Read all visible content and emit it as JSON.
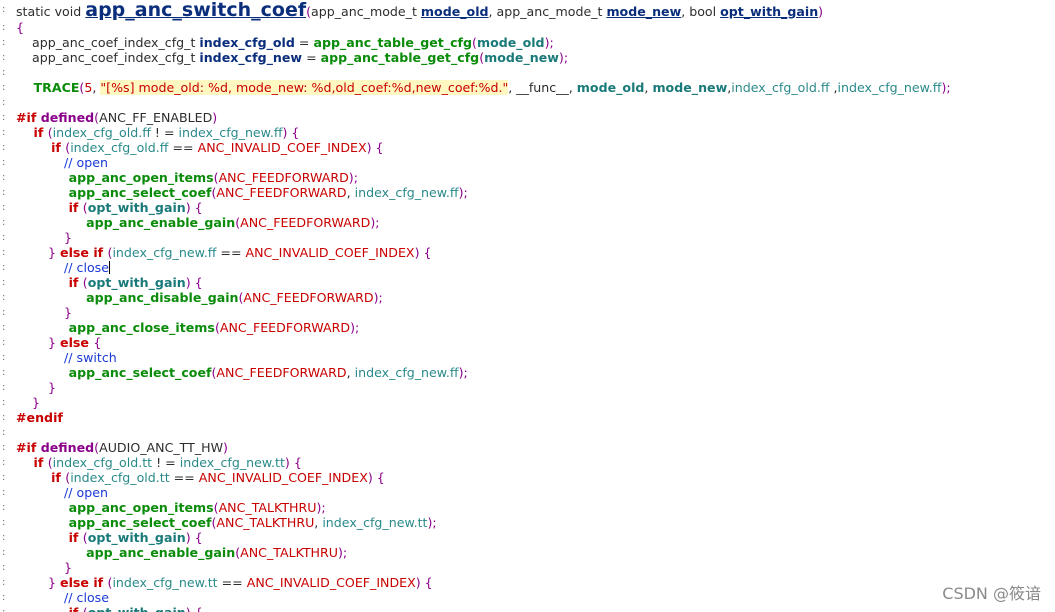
{
  "editor": {
    "watermark": "CSDN @筱谙",
    "lines": [
      {
        "big": true,
        "tokens": [
          [
            "t-kw-norm",
            "static void "
          ],
          [
            "t-fname-big",
            "app_anc_switch_coef"
          ],
          [
            "t-punct",
            "("
          ],
          [
            "t-plain",
            "app_anc_mode_t "
          ],
          [
            "t-param",
            "mode_old"
          ],
          [
            "t-plain",
            ", app_anc_mode_t "
          ],
          [
            "t-param",
            "mode_new"
          ],
          [
            "t-plain",
            ", bool "
          ],
          [
            "t-param",
            "opt_with_gain"
          ],
          [
            "t-punct",
            ")"
          ]
        ]
      },
      {
        "tokens": [
          [
            "t-punct",
            "{"
          ]
        ]
      },
      {
        "tokens": [
          [
            "t-plain",
            "    app_anc_coef_index_cfg_t "
          ],
          [
            "t-var",
            "index_cfg_old"
          ],
          [
            "t-plain",
            " = "
          ],
          [
            "t-func",
            "app_anc_table_get_cfg"
          ],
          [
            "t-punct",
            "("
          ],
          [
            "t-field-b",
            "mode_old"
          ],
          [
            "t-punct",
            ");"
          ]
        ]
      },
      {
        "tokens": [
          [
            "t-plain",
            "    app_anc_coef_index_cfg_t "
          ],
          [
            "t-var",
            "index_cfg_new"
          ],
          [
            "t-plain",
            " = "
          ],
          [
            "t-func",
            "app_anc_table_get_cfg"
          ],
          [
            "t-punct",
            "("
          ],
          [
            "t-field-b",
            "mode_new"
          ],
          [
            "t-punct",
            ");"
          ]
        ]
      },
      {
        "tokens": []
      },
      {
        "tokens": [
          [
            "t-func",
            "    TRACE"
          ],
          [
            "t-punct",
            "("
          ],
          [
            "t-num",
            "5"
          ],
          [
            "t-plain",
            ", "
          ],
          [
            "t-str",
            "\"[%s] mode_old: %d, mode_new: %d,old_coef:%d,new_coef:%d.\""
          ],
          [
            "t-plain",
            ", __func__, "
          ],
          [
            "t-field-b",
            "mode_old"
          ],
          [
            "t-plain",
            ", "
          ],
          [
            "t-field-b",
            "mode_new"
          ],
          [
            "t-plain",
            ","
          ],
          [
            "t-field",
            "index_cfg_old.ff"
          ],
          [
            "t-plain",
            " ,"
          ],
          [
            "t-field",
            "index_cfg_new.ff"
          ],
          [
            "t-punct",
            ");"
          ]
        ]
      },
      {
        "tokens": []
      },
      {
        "tokens": [
          [
            "t-kw",
            "#if "
          ],
          [
            "t-pp",
            "defined"
          ],
          [
            "t-punct",
            "("
          ],
          [
            "t-plain",
            "ANC_FF_ENABLED"
          ],
          [
            "t-punct",
            ")"
          ]
        ]
      },
      {
        "tokens": [
          [
            "t-kw",
            "    if "
          ],
          [
            "t-punct",
            "("
          ],
          [
            "t-field",
            "index_cfg_old.ff"
          ],
          [
            "t-plain",
            " ! = "
          ],
          [
            "t-field",
            "index_cfg_new.ff"
          ],
          [
            "t-punct",
            ") {"
          ]
        ]
      },
      {
        "tokens": [
          [
            "t-kw",
            "        if "
          ],
          [
            "t-punct",
            "("
          ],
          [
            "t-field",
            "index_cfg_old.ff"
          ],
          [
            "t-plain",
            " == "
          ],
          [
            "t-macro",
            "ANC_INVALID_COEF_INDEX"
          ],
          [
            "t-punct",
            ") {"
          ]
        ]
      },
      {
        "tokens": [
          [
            "t-comment",
            "            // open"
          ]
        ]
      },
      {
        "tokens": [
          [
            "t-func",
            "            app_anc_open_items"
          ],
          [
            "t-punct",
            "("
          ],
          [
            "t-macro",
            "ANC_FEEDFORWARD"
          ],
          [
            "t-punct",
            ");"
          ]
        ]
      },
      {
        "tokens": [
          [
            "t-func",
            "            app_anc_select_coef"
          ],
          [
            "t-punct",
            "("
          ],
          [
            "t-macro",
            "ANC_FEEDFORWARD"
          ],
          [
            "t-plain",
            ", "
          ],
          [
            "t-field",
            "index_cfg_new.ff"
          ],
          [
            "t-punct",
            ");"
          ]
        ]
      },
      {
        "tokens": [
          [
            "t-kw",
            "            if "
          ],
          [
            "t-punct",
            "("
          ],
          [
            "t-field-b",
            "opt_with_gain"
          ],
          [
            "t-punct",
            ") {"
          ]
        ]
      },
      {
        "tokens": [
          [
            "t-func",
            "                app_anc_enable_gain"
          ],
          [
            "t-punct",
            "("
          ],
          [
            "t-macro",
            "ANC_FEEDFORWARD"
          ],
          [
            "t-punct",
            ");"
          ]
        ]
      },
      {
        "tokens": [
          [
            "t-punct",
            "            }"
          ]
        ]
      },
      {
        "tokens": [
          [
            "t-punct",
            "        } "
          ],
          [
            "t-kw",
            "else if "
          ],
          [
            "t-punct",
            "("
          ],
          [
            "t-field",
            "index_cfg_new.ff"
          ],
          [
            "t-plain",
            " == "
          ],
          [
            "t-macro",
            "ANC_INVALID_COEF_INDEX"
          ],
          [
            "t-punct",
            ") {"
          ]
        ]
      },
      {
        "caret": true,
        "tokens": [
          [
            "t-comment",
            "            // close"
          ]
        ]
      },
      {
        "tokens": [
          [
            "t-kw",
            "            if "
          ],
          [
            "t-punct",
            "("
          ],
          [
            "t-field-b",
            "opt_with_gain"
          ],
          [
            "t-punct",
            ") {"
          ]
        ]
      },
      {
        "tokens": [
          [
            "t-func",
            "                app_anc_disable_gain"
          ],
          [
            "t-punct",
            "("
          ],
          [
            "t-macro",
            "ANC_FEEDFORWARD"
          ],
          [
            "t-punct",
            ");"
          ]
        ]
      },
      {
        "tokens": [
          [
            "t-punct",
            "            }"
          ]
        ]
      },
      {
        "tokens": [
          [
            "t-func",
            "            app_anc_close_items"
          ],
          [
            "t-punct",
            "("
          ],
          [
            "t-macro",
            "ANC_FEEDFORWARD"
          ],
          [
            "t-punct",
            ");"
          ]
        ]
      },
      {
        "tokens": [
          [
            "t-punct",
            "        } "
          ],
          [
            "t-kw",
            "else "
          ],
          [
            "t-punct",
            "{"
          ]
        ]
      },
      {
        "tokens": [
          [
            "t-comment",
            "            // switch"
          ]
        ]
      },
      {
        "tokens": [
          [
            "t-func",
            "            app_anc_select_coef"
          ],
          [
            "t-punct",
            "("
          ],
          [
            "t-macro",
            "ANC_FEEDFORWARD"
          ],
          [
            "t-plain",
            ", "
          ],
          [
            "t-field",
            "index_cfg_new.ff"
          ],
          [
            "t-punct",
            ");"
          ]
        ]
      },
      {
        "tokens": [
          [
            "t-punct",
            "        }"
          ]
        ]
      },
      {
        "tokens": [
          [
            "t-punct",
            "    }"
          ]
        ]
      },
      {
        "tokens": [
          [
            "t-kw",
            "#endif"
          ]
        ]
      },
      {
        "tokens": []
      },
      {
        "tokens": [
          [
            "t-kw",
            "#if "
          ],
          [
            "t-pp",
            "defined"
          ],
          [
            "t-punct",
            "("
          ],
          [
            "t-plain",
            "AUDIO_ANC_TT_HW"
          ],
          [
            "t-punct",
            ")"
          ]
        ]
      },
      {
        "tokens": [
          [
            "t-kw",
            "    if "
          ],
          [
            "t-punct",
            "("
          ],
          [
            "t-field",
            "index_cfg_old.tt"
          ],
          [
            "t-plain",
            " ! = "
          ],
          [
            "t-field",
            "index_cfg_new.tt"
          ],
          [
            "t-punct",
            ") {"
          ]
        ]
      },
      {
        "tokens": [
          [
            "t-kw",
            "        if "
          ],
          [
            "t-punct",
            "("
          ],
          [
            "t-field",
            "index_cfg_old.tt"
          ],
          [
            "t-plain",
            " == "
          ],
          [
            "t-macro",
            "ANC_INVALID_COEF_INDEX"
          ],
          [
            "t-punct",
            ") {"
          ]
        ]
      },
      {
        "tokens": [
          [
            "t-comment",
            "            // open"
          ]
        ]
      },
      {
        "tokens": [
          [
            "t-func",
            "            app_anc_open_items"
          ],
          [
            "t-punct",
            "("
          ],
          [
            "t-macro",
            "ANC_TALKTHRU"
          ],
          [
            "t-punct",
            ");"
          ]
        ]
      },
      {
        "tokens": [
          [
            "t-func",
            "            app_anc_select_coef"
          ],
          [
            "t-punct",
            "("
          ],
          [
            "t-macro",
            "ANC_TALKTHRU"
          ],
          [
            "t-plain",
            ", "
          ],
          [
            "t-field",
            "index_cfg_new.tt"
          ],
          [
            "t-punct",
            ");"
          ]
        ]
      },
      {
        "tokens": [
          [
            "t-kw",
            "            if "
          ],
          [
            "t-punct",
            "("
          ],
          [
            "t-field-b",
            "opt_with_gain"
          ],
          [
            "t-punct",
            ") {"
          ]
        ]
      },
      {
        "tokens": [
          [
            "t-func",
            "                app_anc_enable_gain"
          ],
          [
            "t-punct",
            "("
          ],
          [
            "t-macro",
            "ANC_TALKTHRU"
          ],
          [
            "t-punct",
            ");"
          ]
        ]
      },
      {
        "tokens": [
          [
            "t-punct",
            "            }"
          ]
        ]
      },
      {
        "tokens": [
          [
            "t-punct",
            "        } "
          ],
          [
            "t-kw",
            "else if "
          ],
          [
            "t-punct",
            "("
          ],
          [
            "t-field",
            "index_cfg_new.tt"
          ],
          [
            "t-plain",
            " == "
          ],
          [
            "t-macro",
            "ANC_INVALID_COEF_INDEX"
          ],
          [
            "t-punct",
            ") {"
          ]
        ]
      },
      {
        "tokens": [
          [
            "t-comment",
            "            // close"
          ]
        ]
      },
      {
        "tokens": [
          [
            "t-kw",
            "            if "
          ],
          [
            "t-punct",
            "("
          ],
          [
            "t-field-b",
            "opt_with_gain"
          ],
          [
            "t-punct",
            ") {"
          ]
        ]
      }
    ]
  }
}
